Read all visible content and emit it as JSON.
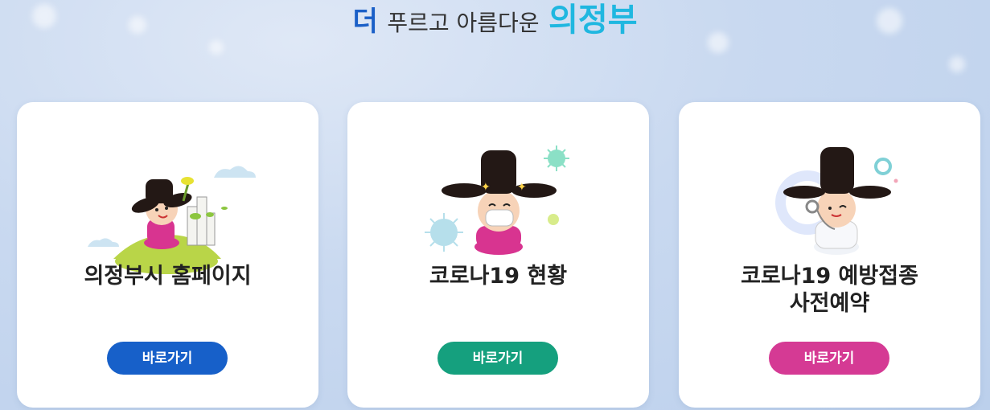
{
  "headline": {
    "word1": "더",
    "word2": "푸르고 아름다운",
    "word3": "의정부"
  },
  "cards": [
    {
      "title_line1": "의정부시 홈페이지",
      "title_line2": "",
      "button_label": "바로가기",
      "button_color": "#1760c9"
    },
    {
      "title_line1": "코로나19 현황",
      "title_line2": "",
      "button_label": "바로가기",
      "button_color": "#15a07e"
    },
    {
      "title_line1": "코로나19 예방접종",
      "title_line2": "사전예약",
      "button_label": "바로가기",
      "button_color": "#d53a94"
    }
  ],
  "colors": {
    "accent_blue": "#1a5fc7",
    "accent_cyan": "#1fb7e0",
    "background": "#c9d9f0"
  }
}
